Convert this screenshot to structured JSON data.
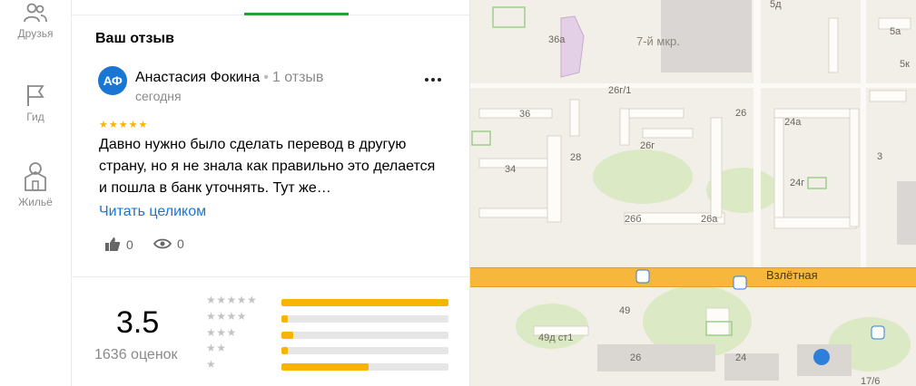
{
  "nav": {
    "items": [
      {
        "label": "Друзья",
        "icon": "friends-icon"
      },
      {
        "label": "Гид",
        "icon": "flag-icon"
      },
      {
        "label": "Жильё",
        "icon": "house-icon"
      }
    ]
  },
  "review": {
    "section_title": "Ваш отзыв",
    "avatar_initials": "АФ",
    "author_name": "Анастасия Фокина",
    "author_reviews": "1 отзыв",
    "date": "сегодня",
    "stars": "★★★★★",
    "text": "Давно нужно было сделать перевод в другую страну, но я не знала как правильно это делается и пошла в банк уточнять. Тут же…",
    "read_more": "Читать целиком",
    "likes": "0",
    "views": "0"
  },
  "rating": {
    "value": "3.5",
    "count_label": "1636 оценок",
    "distribution": [
      {
        "stars": "★★★★★",
        "fraction": 1.0
      },
      {
        "stars": "★★★★",
        "fraction": 0.04
      },
      {
        "stars": "★★★",
        "fraction": 0.07
      },
      {
        "stars": "★★",
        "fraction": 0.04
      },
      {
        "stars": "★",
        "fraction": 0.52
      }
    ]
  },
  "map": {
    "street_name": "Взлётная",
    "district_label": "7-й мкр.",
    "building_numbers": [
      "36а",
      "5д",
      "5а",
      "5к",
      "26г/1",
      "36",
      "26",
      "24а",
      "3",
      "26г",
      "28",
      "34",
      "24г",
      "26б",
      "26а",
      "49",
      "49д ст1",
      "26",
      "24",
      "17/6"
    ]
  },
  "colors": {
    "accent_green": "#2c9b3a",
    "link_blue": "#1976d2",
    "star_yellow": "#f7b500",
    "road_orange": "#f6b73c"
  }
}
